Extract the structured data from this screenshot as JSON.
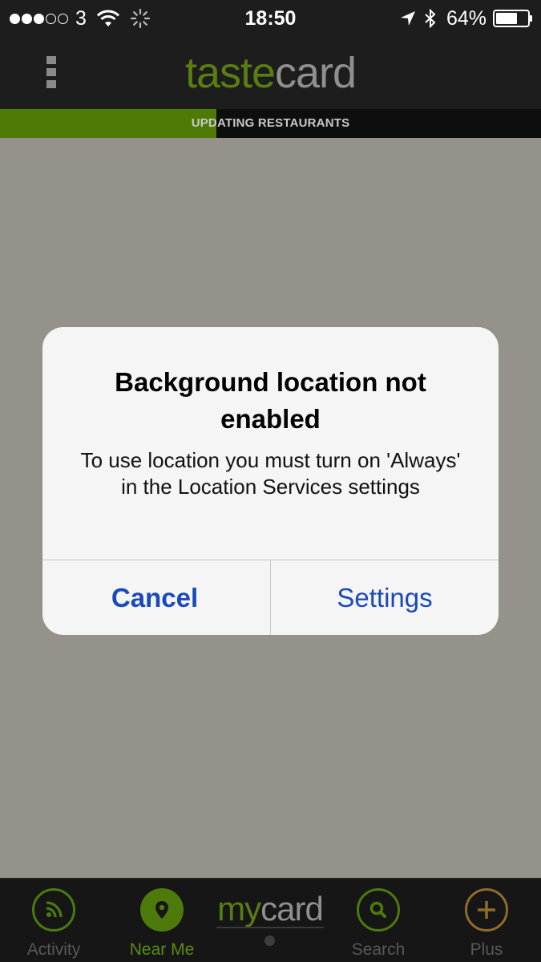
{
  "status_bar": {
    "carrier": "3",
    "time": "18:50",
    "battery": "64%",
    "signal_dots": [
      true,
      true,
      true,
      false,
      false
    ]
  },
  "app": {
    "logo_part1": "taste",
    "logo_part2": "card",
    "logo_colors": {
      "accent": "#5a7d12",
      "muted": "#8f8f8f"
    }
  },
  "progress": {
    "label": "UPDATING RESTAURANTS",
    "fraction": 0.4,
    "color": "#4d7a05"
  },
  "alert": {
    "title": "Background location not enabled",
    "message": "To use location you must turn on 'Always' in the Location Services settings",
    "cancel_label": "Cancel",
    "settings_label": "Settings",
    "button_color": "#1a49b8"
  },
  "tabbar": {
    "activity": {
      "label": "Activity",
      "icon": "rss-icon"
    },
    "near_me": {
      "label": "Near Me",
      "icon": "location-pin-icon",
      "active": true
    },
    "mycard": {
      "logo_part1": "my",
      "logo_part2": "card"
    },
    "search": {
      "label": "Search",
      "icon": "search-icon"
    },
    "plus": {
      "label": "Plus",
      "icon": "plus-icon"
    }
  }
}
